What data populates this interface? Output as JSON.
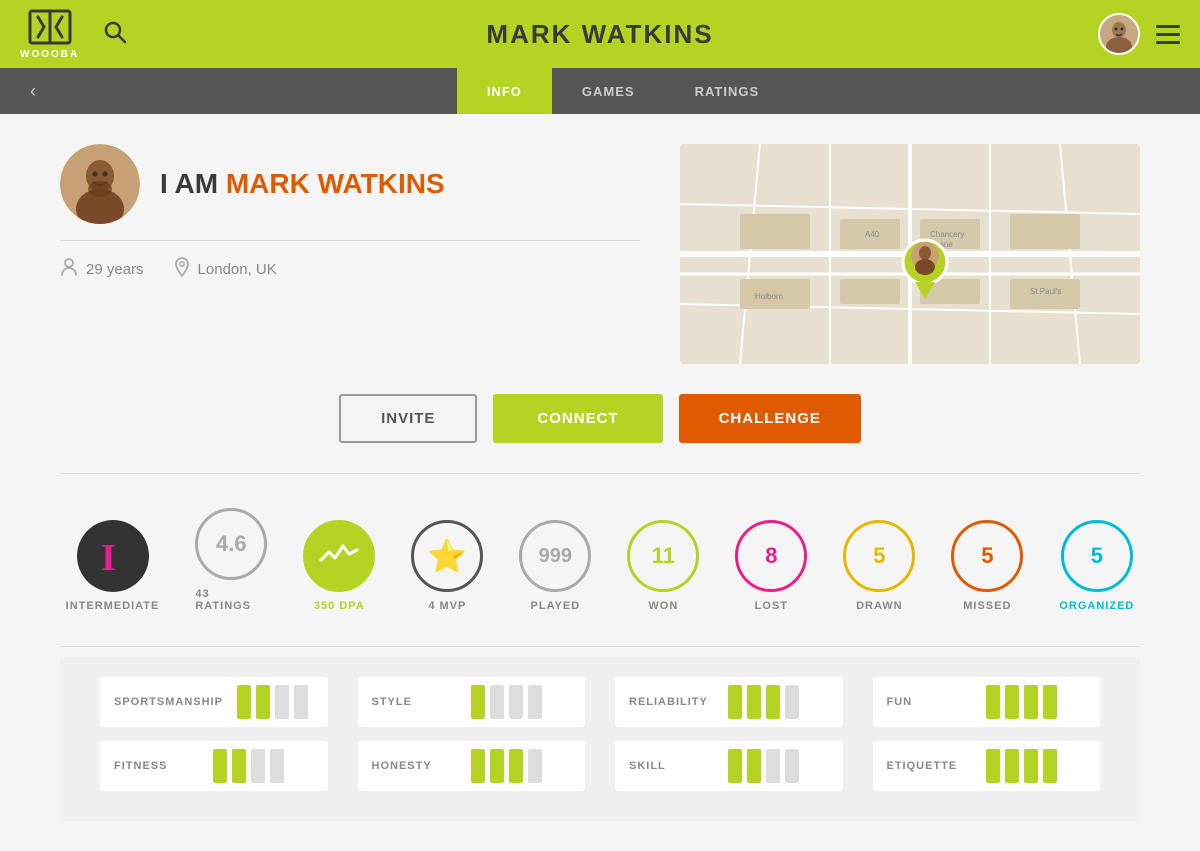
{
  "header": {
    "title": "MARK WATKINS",
    "logo_text": "WOOOBA",
    "search_label": "search"
  },
  "subnav": {
    "back_label": "‹",
    "tabs": [
      {
        "label": "INFO",
        "active": true
      },
      {
        "label": "GAMES",
        "active": false
      },
      {
        "label": "RATINGS",
        "active": false
      }
    ]
  },
  "profile": {
    "name_prefix": "I AM ",
    "name": "MARK WATKINS",
    "age": "29 years",
    "location": "London, UK"
  },
  "actions": {
    "invite": "INVITE",
    "connect": "CONNECT",
    "challenge": "CHALLENGE"
  },
  "stats": [
    {
      "label": "INTERMEDIATE",
      "value": "",
      "type": "intermediate"
    },
    {
      "label": "43 RATINGS",
      "value": "4.6",
      "type": "gray-border"
    },
    {
      "label": "350 DPA",
      "value": "~",
      "type": "green-bg"
    },
    {
      "label": "4 MVP",
      "value": "★",
      "type": "star"
    },
    {
      "label": "PLAYED",
      "value": "999",
      "type": "gray-border"
    },
    {
      "label": "WON",
      "value": "11",
      "type": "green-border"
    },
    {
      "label": "LOST",
      "value": "8",
      "type": "pink"
    },
    {
      "label": "DRAWN",
      "value": "5",
      "type": "yellow-border"
    },
    {
      "label": "MISSED",
      "value": "5",
      "type": "coral"
    },
    {
      "label": "ORGANIZED",
      "value": "5",
      "type": "teal"
    }
  ],
  "ratings": [
    {
      "label": "SPORTSMANSHIP",
      "filled": 2,
      "empty": 2
    },
    {
      "label": "STYLE",
      "filled": 1,
      "empty": 3
    },
    {
      "label": "RELIABILITY",
      "filled": 3,
      "empty": 1
    },
    {
      "label": "FUN",
      "filled": 4,
      "empty": 0
    },
    {
      "label": "FITNESS",
      "filled": 2,
      "empty": 2
    },
    {
      "label": "HONESTY",
      "filled": 3,
      "empty": 1
    },
    {
      "label": "SKILL",
      "filled": 2,
      "empty": 2
    },
    {
      "label": "ETIQUETTE",
      "filled": 4,
      "empty": 0
    }
  ]
}
